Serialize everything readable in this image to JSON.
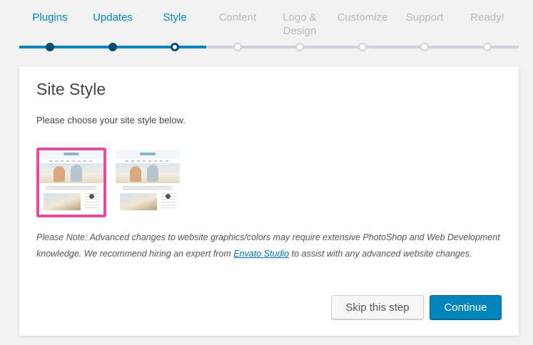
{
  "wizard": {
    "steps": [
      {
        "label": "Plugins",
        "state": "done"
      },
      {
        "label": "Updates",
        "state": "done"
      },
      {
        "label": "Style",
        "state": "current"
      },
      {
        "label": "Content",
        "state": "todo"
      },
      {
        "label": "Logo &\nDesign",
        "state": "todo"
      },
      {
        "label": "Customize",
        "state": "todo"
      },
      {
        "label": "Support",
        "state": "todo"
      },
      {
        "label": "Ready!",
        "state": "todo"
      }
    ],
    "colors": {
      "active": "#0085ba",
      "inactive": "#b4b9be",
      "selected_border": "#e14d9b"
    }
  },
  "panel": {
    "title": "Site Style",
    "intro": "Please choose your site style below.",
    "styles": [
      {
        "name": "style-1",
        "selected": true
      },
      {
        "name": "style-2",
        "selected": false
      }
    ],
    "note_before": "Please Note: Advanced changes to website graphics/colors may require extensive PhotoShop and Web Development knowledge. We recommend hiring an expert from ",
    "note_link": "Envato Studio",
    "note_after": " to assist with any advanced website changes.",
    "skip_label": "Skip this step",
    "continue_label": "Continue"
  }
}
